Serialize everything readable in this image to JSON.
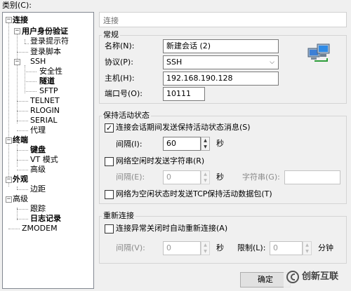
{
  "category_label": "类别(C):",
  "tree": {
    "items": [
      {
        "label": "连接",
        "bold": true
      },
      {
        "label": "用户身份验证",
        "bold": true
      },
      {
        "label": "登录提示符"
      },
      {
        "label": "登录脚本"
      },
      {
        "label": "SSH"
      },
      {
        "label": "安全性"
      },
      {
        "label": "隧道",
        "bold": true
      },
      {
        "label": "SFTP"
      },
      {
        "label": "TELNET"
      },
      {
        "label": "RLOGIN"
      },
      {
        "label": "SERIAL"
      },
      {
        "label": "代理"
      },
      {
        "label": "终端",
        "bold": true
      },
      {
        "label": "键盘",
        "bold": true
      },
      {
        "label": "VT 模式"
      },
      {
        "label": "高级"
      },
      {
        "label": "外观",
        "bold": true
      },
      {
        "label": "边距"
      },
      {
        "label": "高级"
      },
      {
        "label": "跟踪"
      },
      {
        "label": "日志记录",
        "bold": true
      },
      {
        "label": "ZMODEM"
      }
    ]
  },
  "header": {
    "title": "连接"
  },
  "general": {
    "title": "常规",
    "name_label": "名称(N):",
    "name_value": "新建会话 (2)",
    "protocol_label": "协议(P):",
    "protocol_value": "SSH",
    "host_label": "主机(H):",
    "host_value": "192.168.190.128",
    "port_label": "端口号(O):",
    "port_value": "10111"
  },
  "keepalive": {
    "title": "保持活动状态",
    "send_label": "连接会话期间发送保持活动状态消息(S)",
    "send_checked": true,
    "interval_label": "间隔(I):",
    "interval_value": "60",
    "seconds": "秒",
    "idle_label": "网络空闲时发送字符串(R)",
    "idle_checked": false,
    "idle_interval_label": "间隔(E):",
    "idle_interval_value": "0",
    "idle_seconds": "秒",
    "string_label": "字符串(G):",
    "string_value": "",
    "tcp_label": "网络为空闲状态时发送TCP保持活动数据包(T)",
    "tcp_checked": false
  },
  "reconnect": {
    "title": "重新连接",
    "auto_label": "连接异常关闭时自动重新连接(A)",
    "auto_checked": false,
    "interval_label": "间隔(V):",
    "interval_value": "0",
    "seconds": "秒",
    "limit_label": "限制(L):",
    "limit_value": "0",
    "minutes": "分钟"
  },
  "buttons": {
    "ok": "确定"
  },
  "watermark": {
    "text": "创新互联"
  },
  "icons": {
    "spin_up": "▲",
    "spin_down": "▼",
    "dropdown": "⌵",
    "check": "✓",
    "expand": "−"
  }
}
